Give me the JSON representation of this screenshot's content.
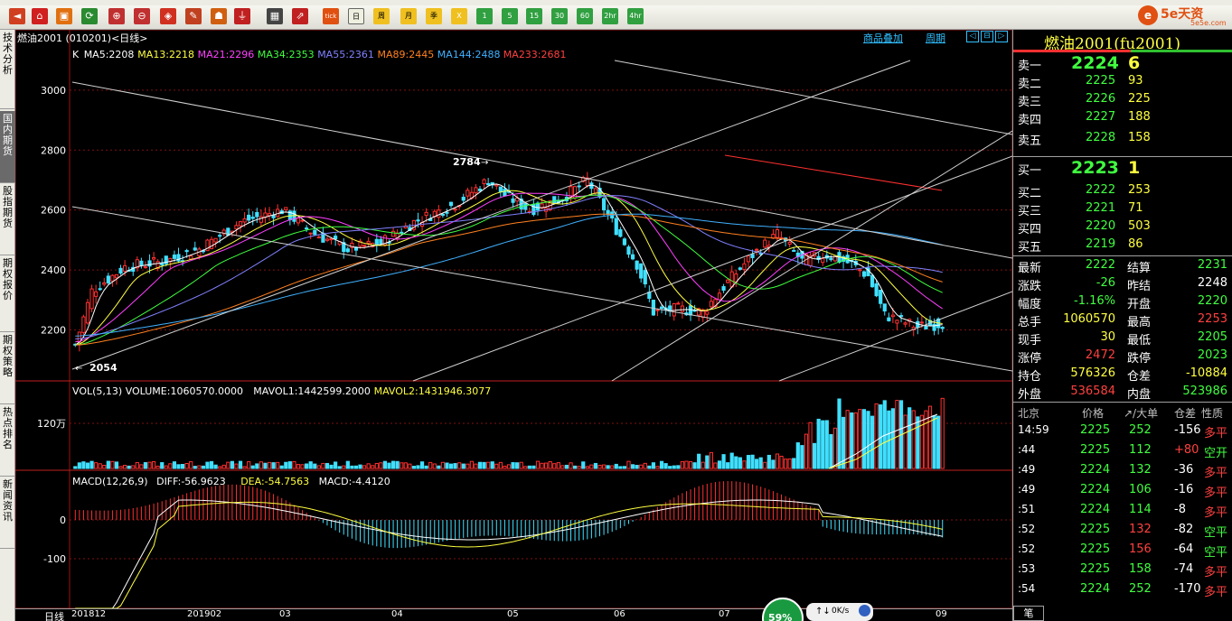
{
  "toolbar": {
    "icons": [
      "back-icon",
      "home-icon",
      "fund-icon",
      "refresh-icon",
      "zoom-in-icon",
      "zoom-out-icon",
      "tag-icon",
      "pen-icon",
      "fire-icon",
      "filter-icon",
      "table-icon",
      "kline-icon",
      "tick-icon",
      "day-icon",
      "week-icon",
      "month-icon",
      "season-icon",
      "minute-1-icon",
      "minute-5-icon",
      "minute-15-icon",
      "minute-30-icon",
      "minute-60-icon",
      "hour-2-icon",
      "hour-4-icon",
      "year-icon"
    ],
    "periods": [
      "日",
      "周",
      "月",
      "季",
      "X",
      "1",
      "5",
      "15",
      "30",
      "60",
      "2hr",
      "4hr",
      "Y"
    ],
    "tick_label": "tick"
  },
  "brand": {
    "circle": "e",
    "name": "5e天资",
    "site": "5e5e.com"
  },
  "left_tabs": [
    "技术分析",
    "国内期货",
    "股指期货",
    "期权报价",
    "期权策略",
    "热点排名",
    "新闻资讯"
  ],
  "chart": {
    "title": "燃油2001 (010201)<日线>",
    "links": [
      "商品叠加",
      "周期"
    ],
    "ma_legend": [
      {
        "text": "K",
        "color": "#ffffff"
      },
      {
        "text": "MA5:2208",
        "color": "#ffffff"
      },
      {
        "text": "MA13:2218",
        "color": "#ffff40"
      },
      {
        "text": "MA21:2296",
        "color": "#ff40ff"
      },
      {
        "text": "MA34:2353",
        "color": "#40ff40"
      },
      {
        "text": "MA55:2361",
        "color": "#8080ff"
      },
      {
        "text": "MA89:2445",
        "color": "#ff8020"
      },
      {
        "text": "MA144:2488",
        "color": "#40b0ff"
      },
      {
        "text": "MA233:2681",
        "color": "#ff4040"
      }
    ],
    "vol_legend": [
      {
        "text": "VOL(5,13) VOLUME:1060570.0000",
        "color": "#ffffff"
      },
      {
        "text": "MAVOL1:1442599.2000",
        "color": "#ffffff"
      },
      {
        "text": "MAVOL2:1431946.3077",
        "color": "#ffff40"
      }
    ],
    "macd_legend": [
      {
        "text": "MACD(12,26,9)",
        "color": "#ffffff"
      },
      {
        "text": "DIFF:-56.9623",
        "color": "#ffffff"
      },
      {
        "text": "DEA:-54.7563",
        "color": "#ffff40"
      },
      {
        "text": "MACD:-4.4120",
        "color": "#ffffff"
      }
    ],
    "y_ticks": [
      "3000",
      "2800",
      "2600",
      "2400",
      "2200"
    ],
    "vol_tick": "120万",
    "macd_ticks": [
      "0",
      "-100"
    ],
    "x_labels": [
      "日线",
      "201812",
      "201902",
      "03",
      "04",
      "05",
      "06",
      "07",
      "08",
      "09"
    ],
    "high_mark": "2784",
    "low_mark": "2054"
  },
  "chart_data": {
    "type": "candlestick",
    "title": "燃油2001 (010201)<日线>",
    "xlabels": [
      "201812",
      "201902",
      "03",
      "04",
      "05",
      "06",
      "07",
      "08",
      "09"
    ],
    "ylim": [
      2030,
      3150
    ],
    "highest": 2784,
    "lowest": 2054,
    "last": 2222
  },
  "quote": {
    "title": "燃油2001(fu2001)",
    "asks": [
      [
        "卖五",
        "2228",
        "158"
      ],
      [
        "卖四",
        "2227",
        "188"
      ],
      [
        "卖三",
        "2226",
        "225"
      ],
      [
        "卖二",
        "2225",
        "93"
      ],
      [
        "卖一",
        "2224",
        "6"
      ]
    ],
    "bids": [
      [
        "买一",
        "2223",
        "1"
      ],
      [
        "买二",
        "2222",
        "253"
      ],
      [
        "买三",
        "2221",
        "71"
      ],
      [
        "买四",
        "2220",
        "503"
      ],
      [
        "买五",
        "2219",
        "86"
      ]
    ],
    "stats": [
      [
        "最新",
        "2222",
        "#40ff40",
        "结算",
        "2231",
        "#40ff40"
      ],
      [
        "涨跌",
        "-26",
        "#40ff40",
        "昨结",
        "2248",
        "#ffffff"
      ],
      [
        "幅度",
        "-1.16%",
        "#40ff40",
        "开盘",
        "2220",
        "#40ff40"
      ],
      [
        "总手",
        "1060570",
        "#ffff40",
        "最高",
        "2253",
        "#ff4040"
      ],
      [
        "现手",
        "30",
        "#ffff40",
        "最低",
        "2205",
        "#40ff40"
      ],
      [
        "涨停",
        "2472",
        "#ff4040",
        "跌停",
        "2023",
        "#40ff40"
      ],
      [
        "持仓",
        "576326",
        "#ffff40",
        "仓差",
        "-10884",
        "#ffff40"
      ],
      [
        "外盘",
        "536584",
        "#ff4040",
        "内盘",
        "523986",
        "#40ff40"
      ]
    ],
    "trade_header": [
      "北京",
      "价格",
      "↗/大单",
      "仓差",
      "性质"
    ],
    "trades": [
      [
        "14:59",
        "2225",
        "252",
        "-156",
        "多平"
      ],
      [
        ":44",
        "2225",
        "112",
        "+80",
        "空开"
      ],
      [
        ":49",
        "2224",
        "132",
        "-36",
        "多平"
      ],
      [
        ":49",
        "2224",
        "106",
        "-16",
        "多平"
      ],
      [
        ":51",
        "2224",
        "114",
        "-8",
        "多平"
      ],
      [
        ":52",
        "2225",
        "132",
        "-82",
        "空平"
      ],
      [
        ":52",
        "2225",
        "156",
        "-64",
        "空平"
      ],
      [
        ":53",
        "2225",
        "158",
        "-74",
        "多平"
      ],
      [
        ":54",
        "2224",
        "252",
        "-170",
        "多平"
      ]
    ],
    "bottom_tab": "笔"
  },
  "status": {
    "percent": "59%",
    "speed": "0K/s"
  }
}
